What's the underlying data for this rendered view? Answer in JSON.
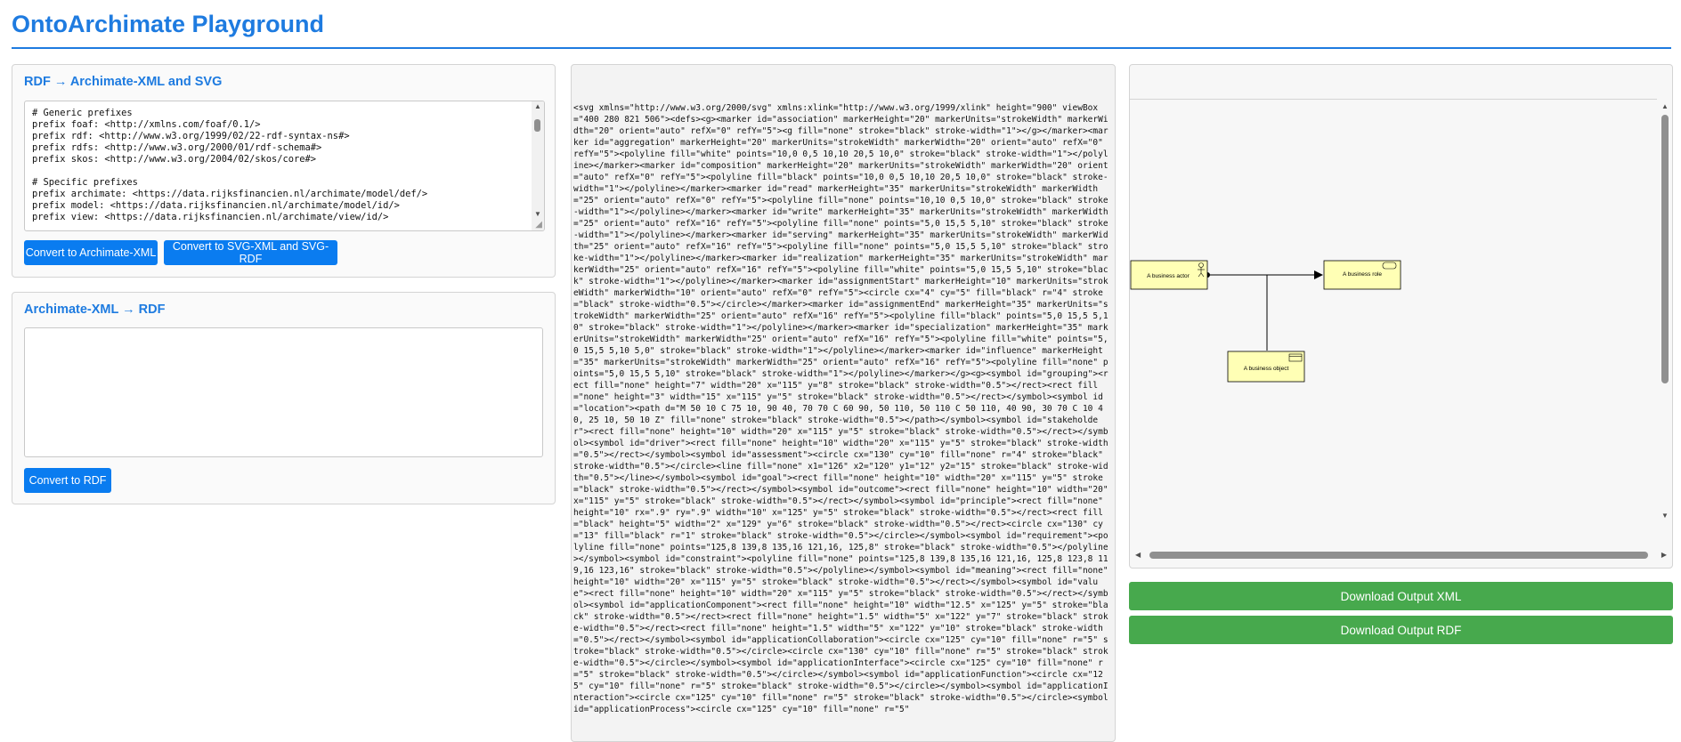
{
  "app": {
    "title": "OntoArchimate Playground"
  },
  "rdf_panel": {
    "heading": "RDF → Archimate-XML and SVG",
    "input_text": "# Generic prefixes\nprefix foaf: <http://xmlns.com/foaf/0.1/>\nprefix rdf: <http://www.w3.org/1999/02/22-rdf-syntax-ns#>\nprefix rdfs: <http://www.w3.org/2000/01/rdf-schema#>\nprefix skos: <http://www.w3.org/2004/02/skos/core#>\n\n# Specific prefixes\nprefix archimate: <https://data.rijksfinancien.nl/archimate/model/def/>\nprefix model: <https://data.rijksfinancien.nl/archimate/model/id/>\nprefix view: <https://data.rijksfinancien.nl/archimate/view/id/>",
    "btn_archimate_xml": "Convert to Archimate-XML",
    "btn_svg": "Convert to SVG-XML and SVG-RDF"
  },
  "xml_panel": {
    "heading": "Archimate-XML → RDF",
    "input_value": "",
    "btn_rdf": "Convert to RDF"
  },
  "svg_output": {
    "text": "<svg xmlns=\"http://www.w3.org/2000/svg\" xmlns:xlink=\"http://www.w3.org/1999/xlink\" height=\"900\" viewBox=\"400 280 821 506\"><defs><g><marker id=\"association\" markerHeight=\"20\" markerUnits=\"strokeWidth\" markerWidth=\"20\" orient=\"auto\" refX=\"0\" refY=\"5\"><g fill=\"none\" stroke=\"black\" stroke-width=\"1\"></g></marker><marker id=\"aggregation\" markerHeight=\"20\" markerUnits=\"strokeWidth\" markerWidth=\"20\" orient=\"auto\" refX=\"0\" refY=\"5\"><polyline fill=\"white\" points=\"10,0 0,5 10,10 20,5 10,0\" stroke=\"black\" stroke-width=\"1\"></polyline></marker><marker id=\"composition\" markerHeight=\"20\" markerUnits=\"strokeWidth\" markerWidth=\"20\" orient=\"auto\" refX=\"0\" refY=\"5\"><polyline fill=\"black\" points=\"10,0 0,5 10,10 20,5 10,0\" stroke=\"black\" stroke-width=\"1\"></polyline></marker><marker id=\"read\" markerHeight=\"35\" markerUnits=\"strokeWidth\" markerWidth=\"25\" orient=\"auto\" refX=\"0\" refY=\"5\"><polyline fill=\"none\" points=\"10,10 0,5 10,0\" stroke=\"black\" stroke-width=\"1\"></polyline></marker><marker id=\"write\" markerHeight=\"35\" markerUnits=\"strokeWidth\" markerWidth=\"25\" orient=\"auto\" refX=\"16\" refY=\"5\"><polyline fill=\"none\" points=\"5,0 15,5 5,10\" stroke=\"black\" stroke-width=\"1\"></polyline></marker><marker id=\"serving\" markerHeight=\"35\" markerUnits=\"strokeWidth\" markerWidth=\"25\" orient=\"auto\" refX=\"16\" refY=\"5\"><polyline fill=\"none\" points=\"5,0 15,5 5,10\" stroke=\"black\" stroke-width=\"1\"></polyline></marker><marker id=\"realization\" markerHeight=\"35\" markerUnits=\"strokeWidth\" markerWidth=\"25\" orient=\"auto\" refX=\"16\" refY=\"5\"><polyline fill=\"white\" points=\"5,0 15,5 5,10\" stroke=\"black\" stroke-width=\"1\"></polyline></marker><marker id=\"assignmentStart\" markerHeight=\"10\" markerUnits=\"strokeWidth\" markerWidth=\"10\" orient=\"auto\" refX=\"0\" refY=\"5\"><circle cx=\"4\" cy=\"5\" fill=\"black\" r=\"4\" stroke=\"black\" stroke-width=\"0.5\"></circle></marker><marker id=\"assignmentEnd\" markerHeight=\"35\" markerUnits=\"strokeWidth\" markerWidth=\"25\" orient=\"auto\" refX=\"16\" refY=\"5\"><polyline fill=\"black\" points=\"5,0 15,5 5,10\" stroke=\"black\" stroke-width=\"1\"></polyline></marker><marker id=\"specialization\" markerHeight=\"35\" markerUnits=\"strokeWidth\" markerWidth=\"25\" orient=\"auto\" refX=\"16\" refY=\"5\"><polyline fill=\"white\" points=\"5,0 15,5 5,10 5,0\" stroke=\"black\" stroke-width=\"1\"></polyline></marker><marker id=\"influence\" markerHeight=\"35\" markerUnits=\"strokeWidth\" markerWidth=\"25\" orient=\"auto\" refX=\"16\" refY=\"5\"><polyline fill=\"none\" points=\"5,0 15,5 5,10\" stroke=\"black\" stroke-width=\"1\"></polyline></marker></g><g><symbol id=\"grouping\"><rect fill=\"none\" height=\"7\" width=\"20\" x=\"115\" y=\"8\" stroke=\"black\" stroke-width=\"0.5\"></rect><rect fill=\"none\" height=\"3\" width=\"15\" x=\"115\" y=\"5\" stroke=\"black\" stroke-width=\"0.5\"></rect></symbol><symbol id=\"location\"><path d=\"M 50 10 C 75 10, 90 40, 70 70 C 60 90, 50 110, 50 110 C 50 110, 40 90, 30 70 C 10 40, 25 10, 50 10 Z\" fill=\"none\" stroke=\"black\" stroke-width=\"0.5\"></path></symbol><symbol id=\"stakeholder\"><rect fill=\"none\" height=\"10\" width=\"20\" x=\"115\" y=\"5\" stroke=\"black\" stroke-width=\"0.5\"></rect></symbol><symbol id=\"driver\"><rect fill=\"none\" height=\"10\" width=\"20\" x=\"115\" y=\"5\" stroke=\"black\" stroke-width=\"0.5\"></rect></symbol><symbol id=\"assessment\"><circle cx=\"130\" cy=\"10\" fill=\"none\" r=\"4\" stroke=\"black\" stroke-width=\"0.5\"></circle><line fill=\"none\" x1=\"126\" x2=\"120\" y1=\"12\" y2=\"15\" stroke=\"black\" stroke-width=\"0.5\"></line></symbol><symbol id=\"goal\"><rect fill=\"none\" height=\"10\" width=\"20\" x=\"115\" y=\"5\" stroke=\"black\" stroke-width=\"0.5\"></rect></symbol><symbol id=\"outcome\"><rect fill=\"none\" height=\"10\" width=\"20\" x=\"115\" y=\"5\" stroke=\"black\" stroke-width=\"0.5\"></rect></symbol><symbol id=\"principle\"><rect fill=\"none\" height=\"10\" rx=\".9\" ry=\".9\" width=\"10\" x=\"125\" y=\"5\" stroke=\"black\" stroke-width=\"0.5\"></rect><rect fill=\"black\" height=\"5\" width=\"2\" x=\"129\" y=\"6\" stroke=\"black\" stroke-width=\"0.5\"></rect><circle cx=\"130\" cy=\"13\" fill=\"black\" r=\"1\" stroke=\"black\" stroke-width=\"0.5\"></circle></symbol><symbol id=\"requirement\"><polyline fill=\"none\" points=\"125,8 139,8 135,16 121,16, 125,8\" stroke=\"black\" stroke-width=\"0.5\"></polyline></symbol><symbol id=\"constraint\"><polyline fill=\"none\" points=\"125,8 139,8 135,16 121,16, 125,8 123,8 119,16 123,16\" stroke=\"black\" stroke-width=\"0.5\"></polyline></symbol><symbol id=\"meaning\"><rect fill=\"none\" height=\"10\" width=\"20\" x=\"115\" y=\"5\" stroke=\"black\" stroke-width=\"0.5\"></rect></symbol><symbol id=\"value\"><rect fill=\"none\" height=\"10\" width=\"20\" x=\"115\" y=\"5\" stroke=\"black\" stroke-width=\"0.5\"></rect></symbol><symbol id=\"applicationComponent\"><rect fill=\"none\" height=\"10\" width=\"12.5\" x=\"125\" y=\"5\" stroke=\"black\" stroke-width=\"0.5\"></rect><rect fill=\"none\" height=\"1.5\" width=\"5\" x=\"122\" y=\"7\" stroke=\"black\" stroke-width=\"0.5\"></rect><rect fill=\"none\" height=\"1.5\" width=\"5\" x=\"122\" y=\"10\" stroke=\"black\" stroke-width=\"0.5\"></rect></symbol><symbol id=\"applicationCollaboration\"><circle cx=\"125\" cy=\"10\" fill=\"none\" r=\"5\" stroke=\"black\" stroke-width=\"0.5\"></circle><circle cx=\"130\" cy=\"10\" fill=\"none\" r=\"5\" stroke=\"black\" stroke-width=\"0.5\"></circle></symbol><symbol id=\"applicationInterface\"><circle cx=\"125\" cy=\"10\" fill=\"none\" r=\"5\" stroke=\"black\" stroke-width=\"0.5\"></circle></symbol><symbol id=\"applicationFunction\"><circle cx=\"125\" cy=\"10\" fill=\"none\" r=\"5\" stroke=\"black\" stroke-width=\"0.5\"></circle></symbol><symbol id=\"applicationInteraction\"><circle cx=\"125\" cy=\"10\" fill=\"none\" r=\"5\" stroke=\"black\" stroke-width=\"0.5\"></circle><symbol id=\"applicationProcess\"><circle cx=\"125\" cy=\"10\" fill=\"none\" r=\"5\""
  },
  "preview": {
    "elements": [
      {
        "label": "A business actor",
        "icon": "actor-icon"
      },
      {
        "label": "A business role",
        "icon": "role-icon"
      },
      {
        "label": "A business object",
        "icon": "object-icon"
      }
    ],
    "element_fill": "#ffffb5"
  },
  "downloads": {
    "xml_label": "Download Output XML",
    "rdf_label": "Download Output RDF"
  },
  "colors": {
    "accent": "#1e7be0",
    "primary_button": "#0a7cf0",
    "download_button": "#47a94d"
  }
}
